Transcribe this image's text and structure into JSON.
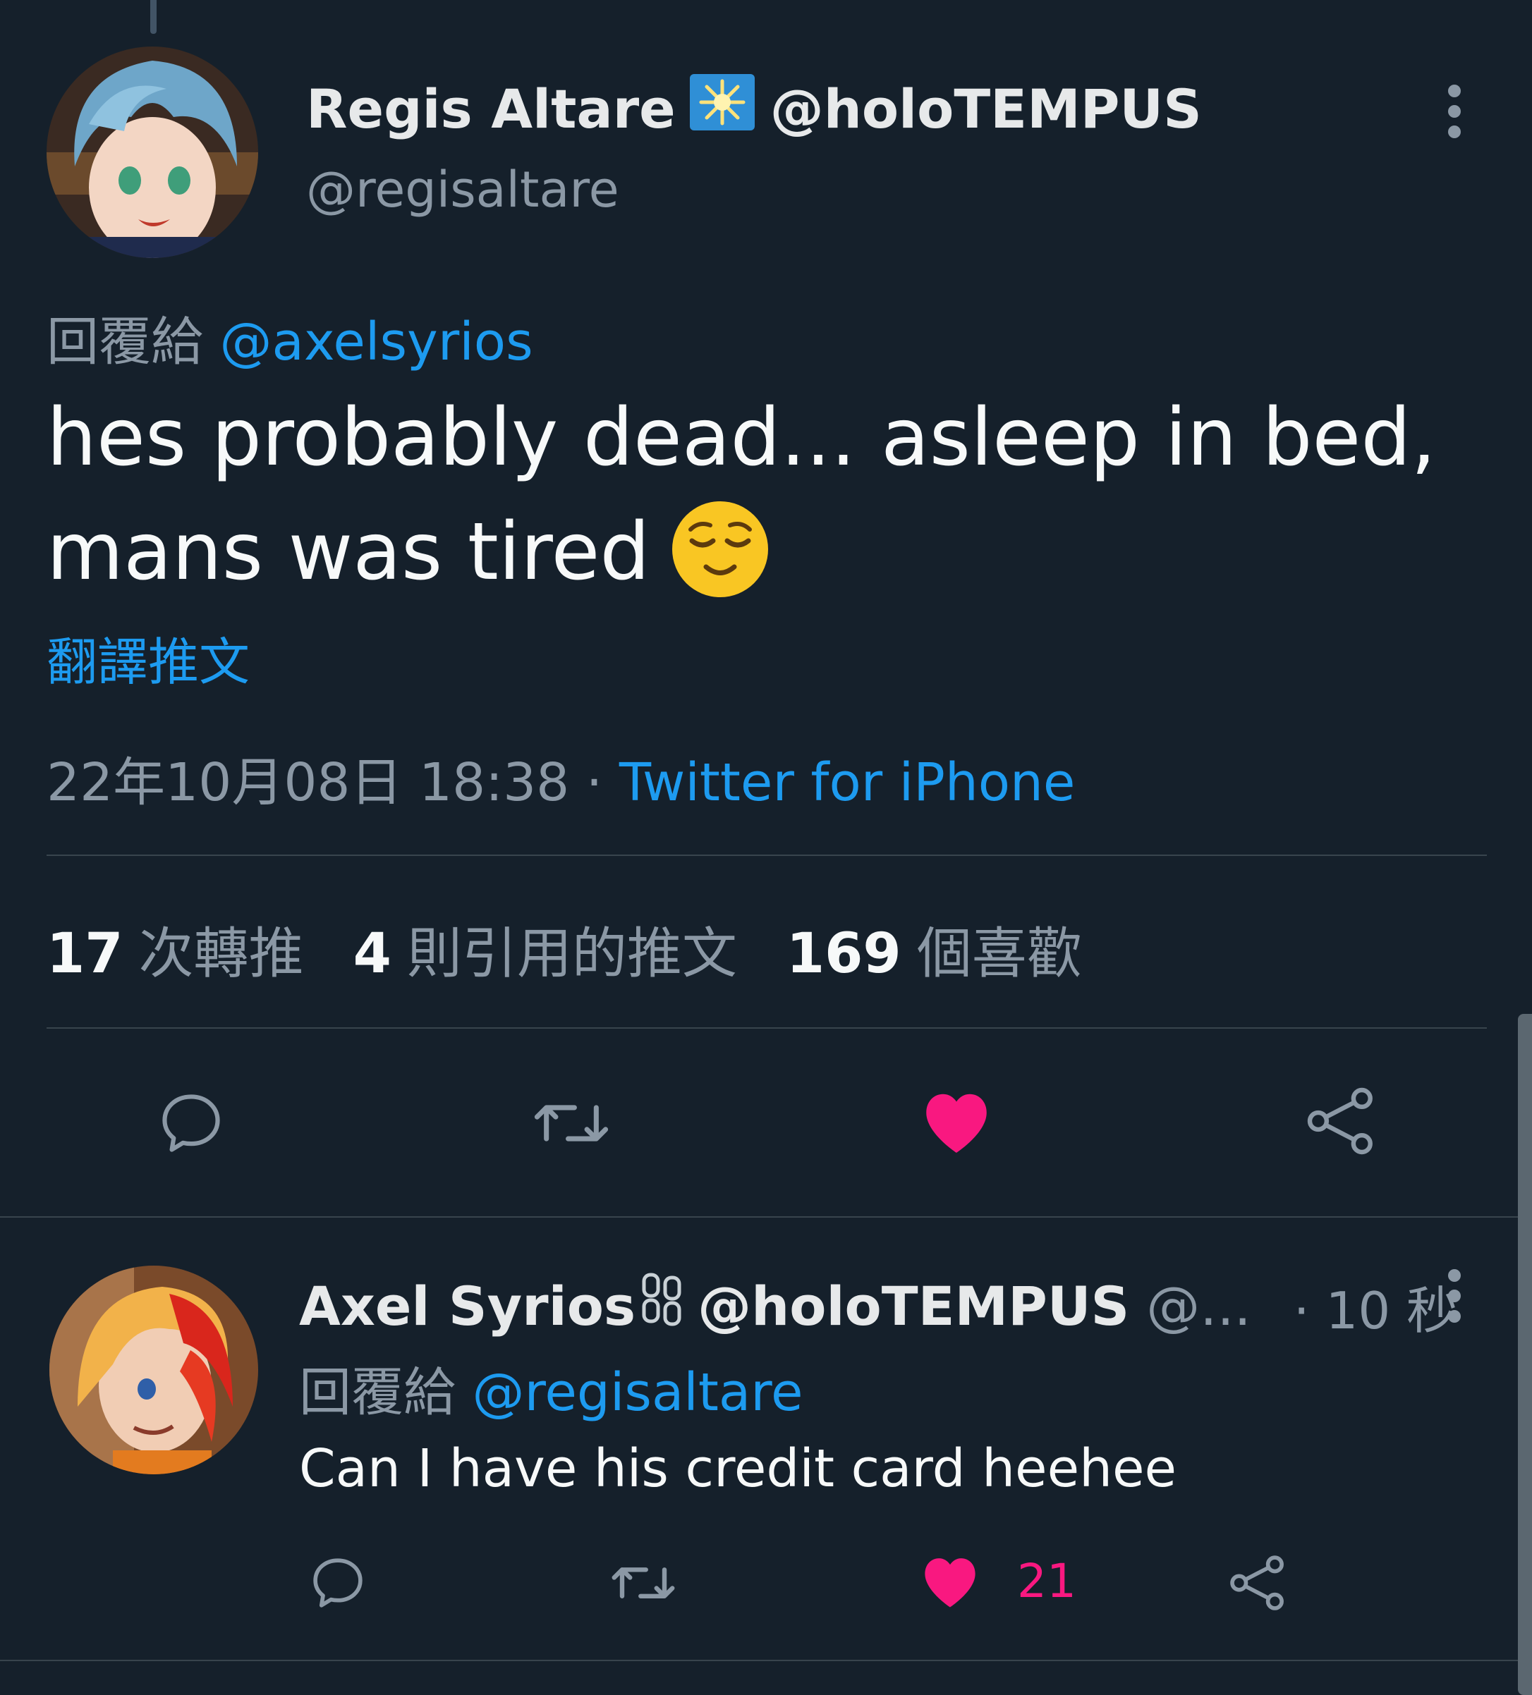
{
  "main_tweet": {
    "display_name": "Regis Altare",
    "name_suffix": "@holoTEMPUS",
    "handle": "@regisaltare",
    "reply_prefix": "回覆給",
    "reply_to": "@axelsyrios",
    "text": "hes probably dead... asleep in bed, mans was tired",
    "emoji": "relieved-face",
    "translate_label": "翻譯推文",
    "timestamp": "22年10月08日 18:38",
    "separator": "·",
    "source": "Twitter for iPhone"
  },
  "stats": [
    {
      "count": "17",
      "label": "次轉推"
    },
    {
      "count": "4",
      "label": "則引用的推文"
    },
    {
      "count": "169",
      "label": "個喜歡"
    }
  ],
  "reply_tweet": {
    "display_name": "Axel Syrios",
    "name_suffix": "@holoTEMPUS",
    "handle_truncated": "@...",
    "time": "· 10 秒",
    "reply_prefix": "回覆給",
    "reply_to": "@regisaltare",
    "text": "Can I have his credit card heehee",
    "like_count": "21"
  },
  "colors": {
    "background": "#15202b",
    "link": "#1d9bf0",
    "muted": "#8b98a5",
    "like": "#f91880"
  }
}
